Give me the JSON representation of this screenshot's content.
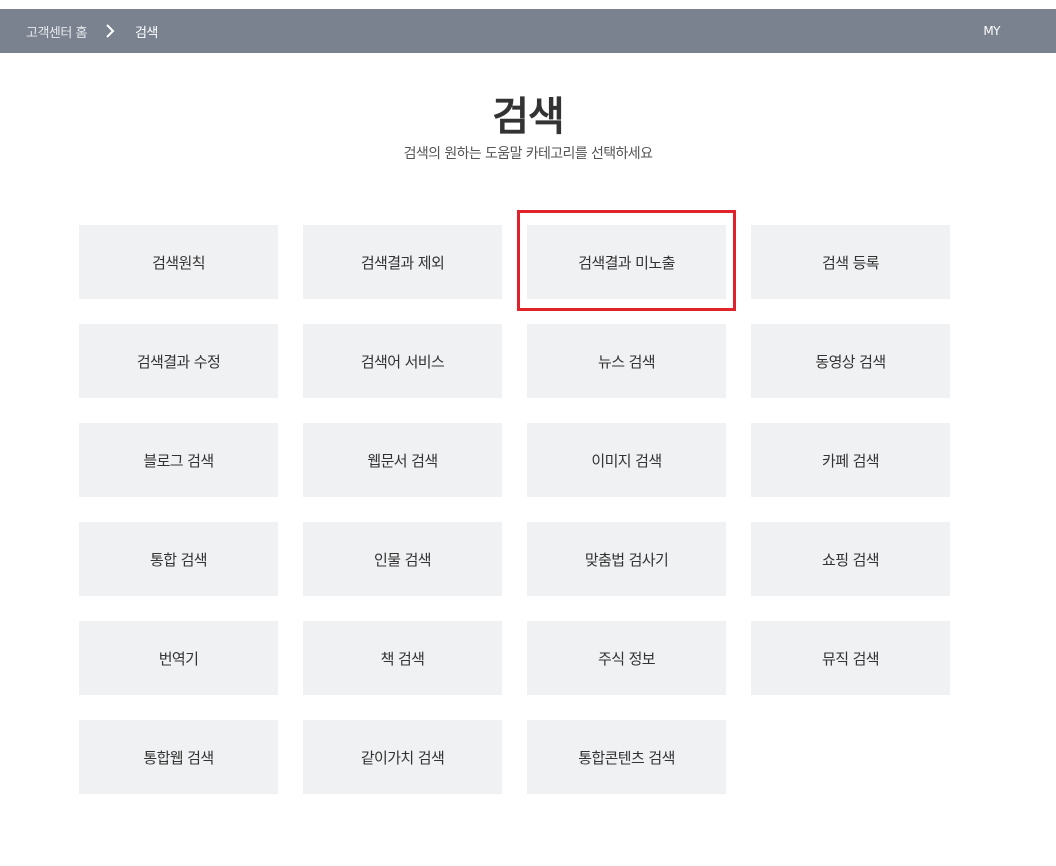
{
  "breadcrumb": {
    "home": "고객센터 홈",
    "current": "검색"
  },
  "header": {
    "my": "MY"
  },
  "page": {
    "title": "검색",
    "subtitle": "검색의 원하는 도움말 카테고리를 선택하세요"
  },
  "categories": [
    "검색원칙",
    "검색결과 제외",
    "검색결과 미노출",
    "검색 등록",
    "검색결과 수정",
    "검색어 서비스",
    "뉴스 검색",
    "동영상 검색",
    "블로그 검색",
    "웹문서 검색",
    "이미지 검색",
    "카페 검색",
    "통합 검색",
    "인물 검색",
    "맞춤법 검사기",
    "쇼핑 검색",
    "번역기",
    "책 검색",
    "주식 정보",
    "뮤직 검색",
    "통합웹 검색",
    "같이가치 검색",
    "통합콘텐츠 검색"
  ],
  "highlight_color": "#e0222b",
  "topbar_color": "#7a8290",
  "icons": {
    "breadcrumb_separator": "chevron-right-icon"
  }
}
